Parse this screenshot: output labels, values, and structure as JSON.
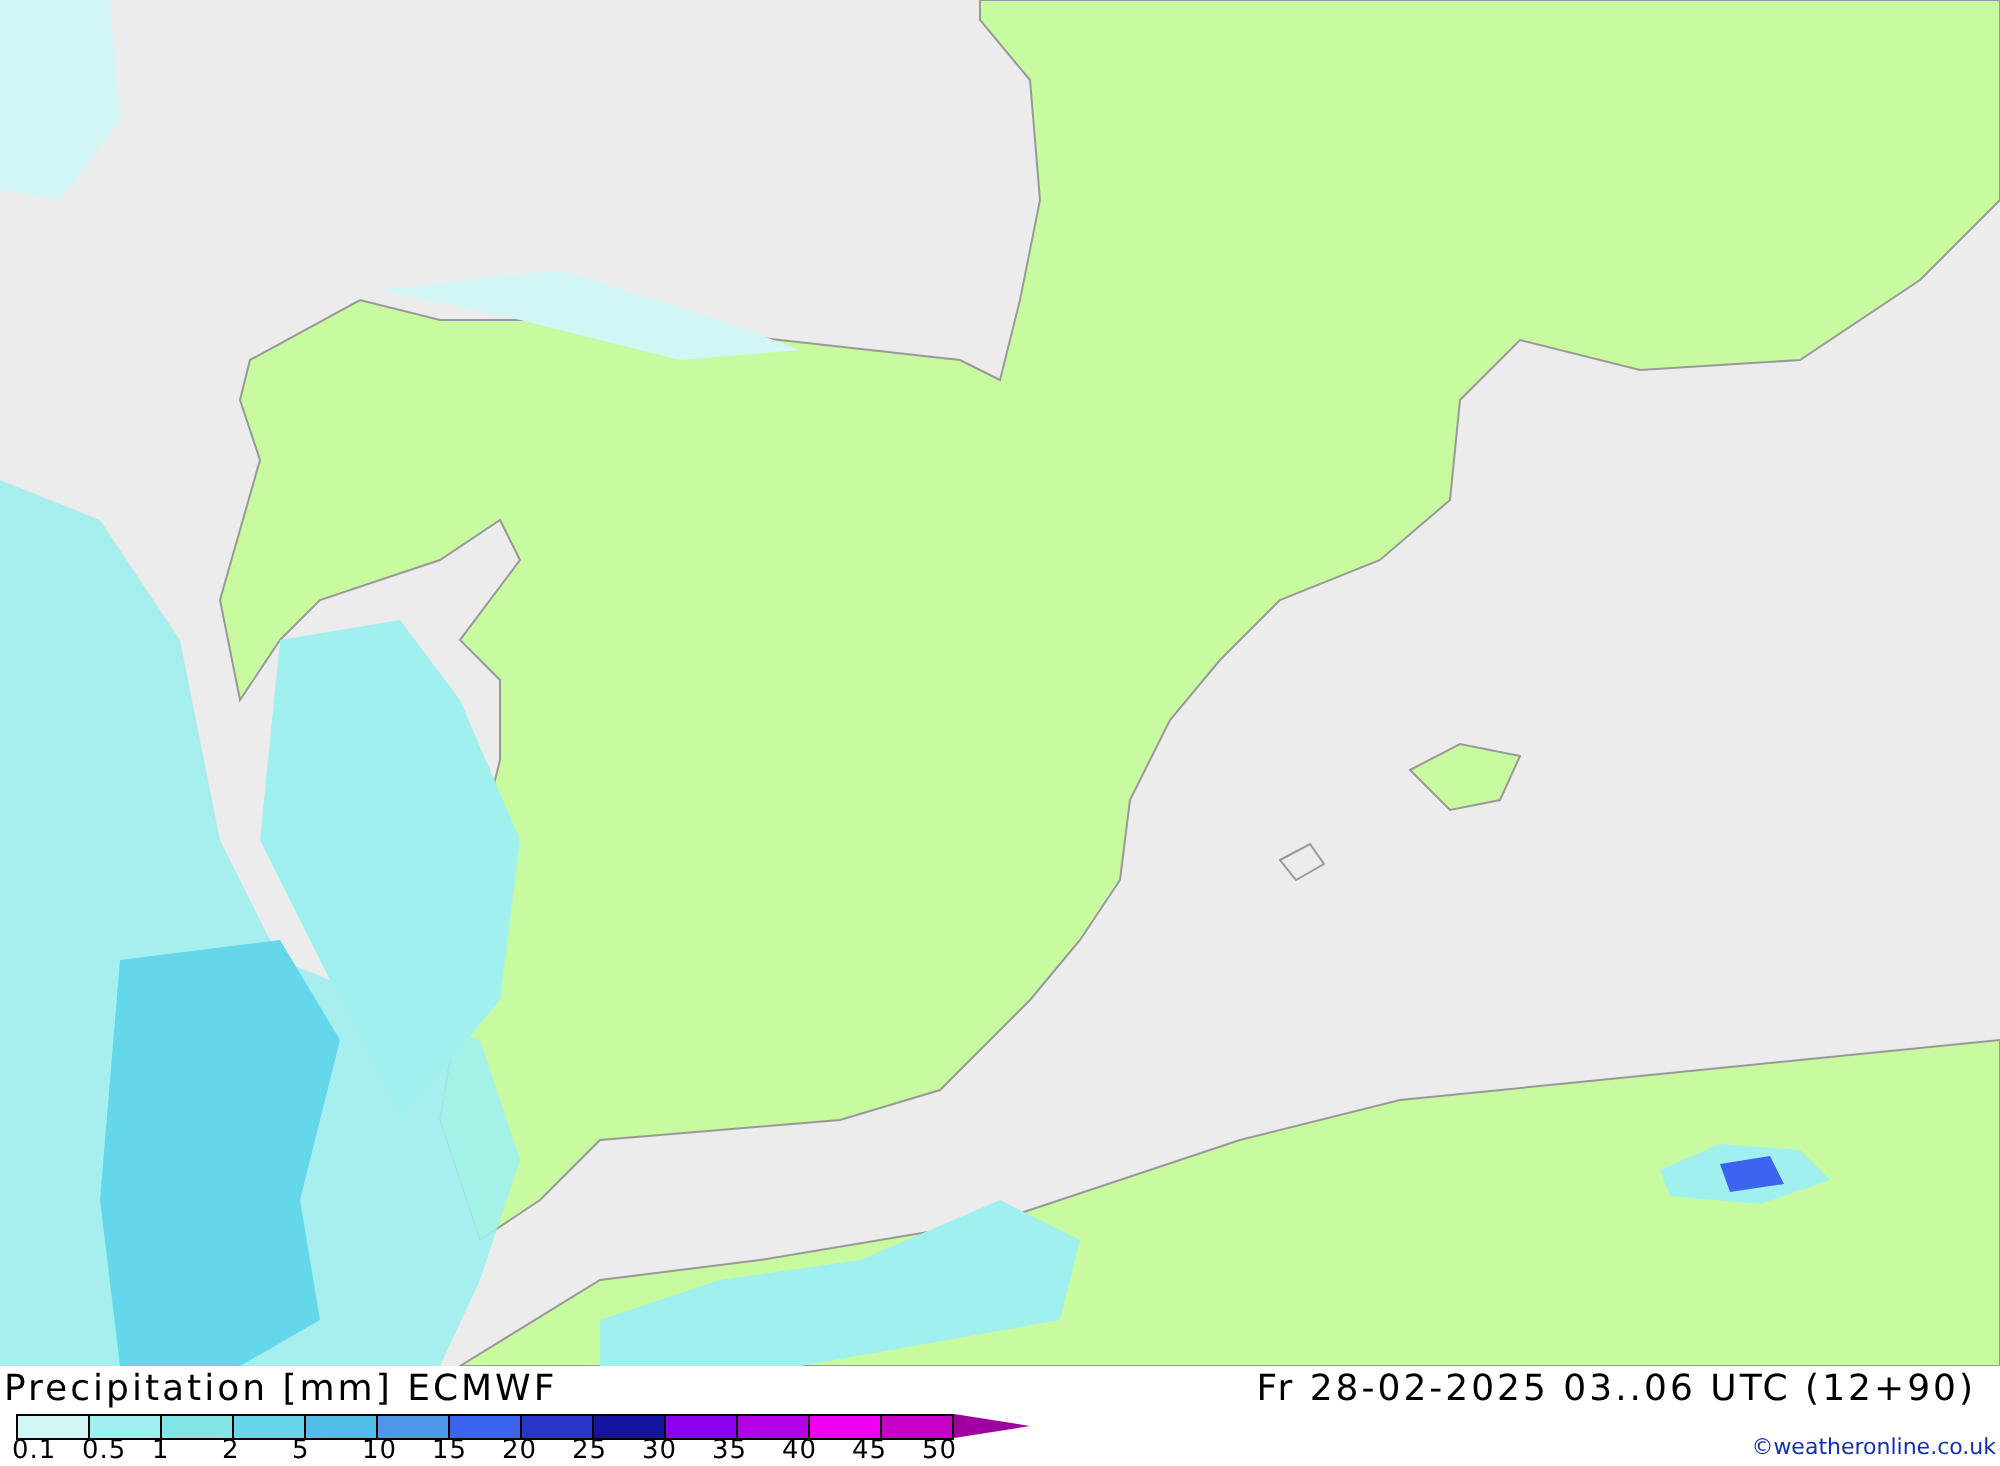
{
  "title": "Precipitation [mm] ECMWF",
  "valid_time": "Fr 28-02-2025 03..06 UTC (12+90)",
  "legend": [
    {
      "label": "0.1",
      "color": "#d2f5f5"
    },
    {
      "label": "0.5",
      "color": "#a0f0f0"
    },
    {
      "label": "1",
      "color": "#82e6e6"
    },
    {
      "label": "2",
      "color": "#64d7eb"
    },
    {
      "label": "5",
      "color": "#50bee6"
    },
    {
      "label": "10",
      "color": "#5096eb"
    },
    {
      "label": "15",
      "color": "#3c64f0"
    },
    {
      "label": "20",
      "color": "#2837c8"
    },
    {
      "label": "25",
      "color": "#1414a0"
    },
    {
      "label": "30",
      "color": "#8c00f0"
    },
    {
      "label": "35",
      "color": "#b400e6"
    },
    {
      "label": "40",
      "color": "#f000f0"
    },
    {
      "label": "45",
      "color": "#c800c8"
    },
    {
      "label": "50",
      "color": "#a000a0"
    }
  ],
  "credit": "©weatheronline.co.uk"
}
